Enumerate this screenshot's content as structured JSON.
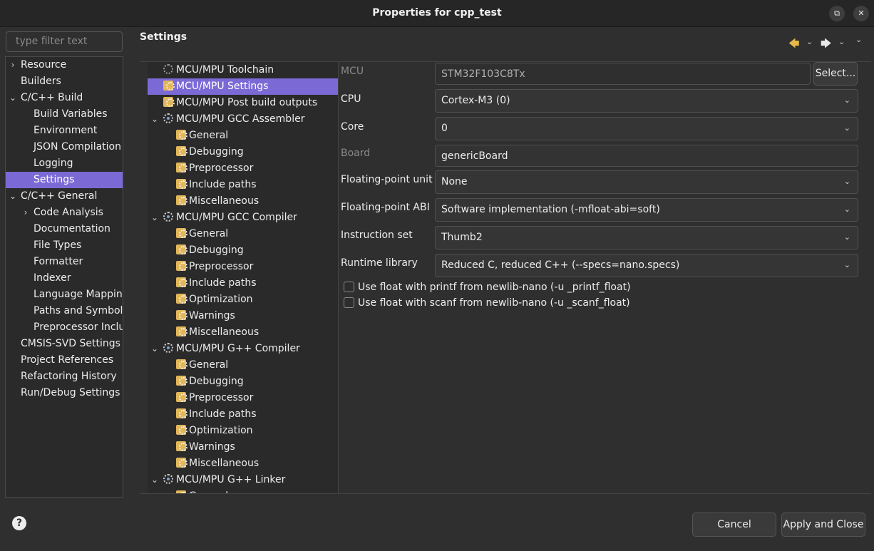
{
  "window": {
    "title": "Properties for cpp_test",
    "restore_glyph": "⧉",
    "close_glyph": "✕"
  },
  "filter": {
    "placeholder": "type filter text"
  },
  "nav": {
    "items": [
      {
        "label": "Resource",
        "chevron": "›"
      },
      {
        "label": "Builders",
        "chevron": ""
      },
      {
        "label": "C/C++ Build",
        "chevron": "⌄"
      },
      {
        "label": "Build Variables",
        "chevron": ""
      },
      {
        "label": "Environment",
        "chevron": ""
      },
      {
        "label": "JSON Compilation",
        "chevron": ""
      },
      {
        "label": "Logging",
        "chevron": ""
      },
      {
        "label": "Settings",
        "chevron": "",
        "selected": true
      },
      {
        "label": "C/C++ General",
        "chevron": "⌄"
      },
      {
        "label": "Code Analysis",
        "chevron": "›"
      },
      {
        "label": "Documentation",
        "chevron": ""
      },
      {
        "label": "File Types",
        "chevron": ""
      },
      {
        "label": "Formatter",
        "chevron": ""
      },
      {
        "label": "Indexer",
        "chevron": ""
      },
      {
        "label": "Language Mapping",
        "chevron": ""
      },
      {
        "label": "Paths and Symbols",
        "chevron": ""
      },
      {
        "label": "Preprocessor Inclu",
        "chevron": ""
      },
      {
        "label": "CMSIS-SVD Settings",
        "chevron": ""
      },
      {
        "label": "Project References",
        "chevron": ""
      },
      {
        "label": "Refactoring History",
        "chevron": ""
      },
      {
        "label": "Run/Debug Settings",
        "chevron": ""
      }
    ]
  },
  "header": {
    "title": "Settings",
    "back_glyph": "🡄",
    "forward_glyph": "🡆",
    "dropdown_glyph": "⌄"
  },
  "tool_tree": {
    "items": [
      {
        "label": "MCU/MPU Toolchain",
        "icon": "tool-icon",
        "chevron": ""
      },
      {
        "label": "MCU/MPU Settings",
        "icon": "folder-gear-icon",
        "chevron": "",
        "selected": true
      },
      {
        "label": "MCU/MPU Post build outputs",
        "icon": "folder-gear-icon",
        "chevron": ""
      },
      {
        "label": "MCU/MPU GCC Assembler",
        "icon": "gear-icon",
        "chevron": "⌄"
      },
      {
        "label": "General",
        "icon": "folder-gear-icon",
        "chevron": ""
      },
      {
        "label": "Debugging",
        "icon": "folder-gear-icon",
        "chevron": ""
      },
      {
        "label": "Preprocessor",
        "icon": "folder-gear-icon",
        "chevron": ""
      },
      {
        "label": "Include paths",
        "icon": "folder-gear-icon",
        "chevron": ""
      },
      {
        "label": "Miscellaneous",
        "icon": "folder-gear-icon",
        "chevron": ""
      },
      {
        "label": "MCU/MPU GCC Compiler",
        "icon": "gear-icon",
        "chevron": "⌄"
      },
      {
        "label": "General",
        "icon": "folder-gear-icon",
        "chevron": ""
      },
      {
        "label": "Debugging",
        "icon": "folder-gear-icon",
        "chevron": ""
      },
      {
        "label": "Preprocessor",
        "icon": "folder-gear-icon",
        "chevron": ""
      },
      {
        "label": "Include paths",
        "icon": "folder-gear-icon",
        "chevron": ""
      },
      {
        "label": "Optimization",
        "icon": "folder-gear-icon",
        "chevron": ""
      },
      {
        "label": "Warnings",
        "icon": "folder-gear-icon",
        "chevron": ""
      },
      {
        "label": "Miscellaneous",
        "icon": "folder-gear-icon",
        "chevron": ""
      },
      {
        "label": "MCU/MPU G++ Compiler",
        "icon": "gear-icon",
        "chevron": "⌄"
      },
      {
        "label": "General",
        "icon": "folder-gear-icon",
        "chevron": ""
      },
      {
        "label": "Debugging",
        "icon": "folder-gear-icon",
        "chevron": ""
      },
      {
        "label": "Preprocessor",
        "icon": "folder-gear-icon",
        "chevron": ""
      },
      {
        "label": "Include paths",
        "icon": "folder-gear-icon",
        "chevron": ""
      },
      {
        "label": "Optimization",
        "icon": "folder-gear-icon",
        "chevron": ""
      },
      {
        "label": "Warnings",
        "icon": "folder-gear-icon",
        "chevron": ""
      },
      {
        "label": "Miscellaneous",
        "icon": "folder-gear-icon",
        "chevron": ""
      },
      {
        "label": "MCU/MPU G++ Linker",
        "icon": "gear-icon",
        "chevron": "⌄"
      },
      {
        "label": "General",
        "icon": "folder-gear-icon",
        "chevron": ""
      }
    ]
  },
  "form": {
    "mcu_label": "MCU",
    "mcu_value": "STM32F103C8Tx",
    "select_button": "Select...",
    "cpu_label": "CPU",
    "cpu_value": "Cortex-M3 (0)",
    "core_label": "Core",
    "core_value": "0",
    "board_label": "Board",
    "board_value": "genericBoard",
    "fpu_label": "Floating-point unit",
    "fpu_value": "None",
    "fpabi_label": "Floating-point ABI",
    "fpabi_value": "Software implementation (-mfloat-abi=soft)",
    "iset_label": "Instruction set",
    "iset_value": "Thumb2",
    "runtime_label": "Runtime library",
    "runtime_value": "Reduced C, reduced C++ (--specs=nano.specs)",
    "printf_float_label": "Use float with printf from newlib-nano (-u _printf_float)",
    "printf_float_checked": false,
    "scanf_float_label": "Use float with scanf from newlib-nano (-u _scanf_float)",
    "scanf_float_checked": false,
    "dropdown_glyph": "⌄"
  },
  "footer": {
    "help_glyph": "?",
    "cancel_label": "Cancel",
    "apply_close_label": "Apply and Close"
  },
  "colors": {
    "selection": "#7b6ad6",
    "background": "#2f2f2f",
    "folder": "#e2b75a",
    "back_arrow": "#e6b84a"
  }
}
